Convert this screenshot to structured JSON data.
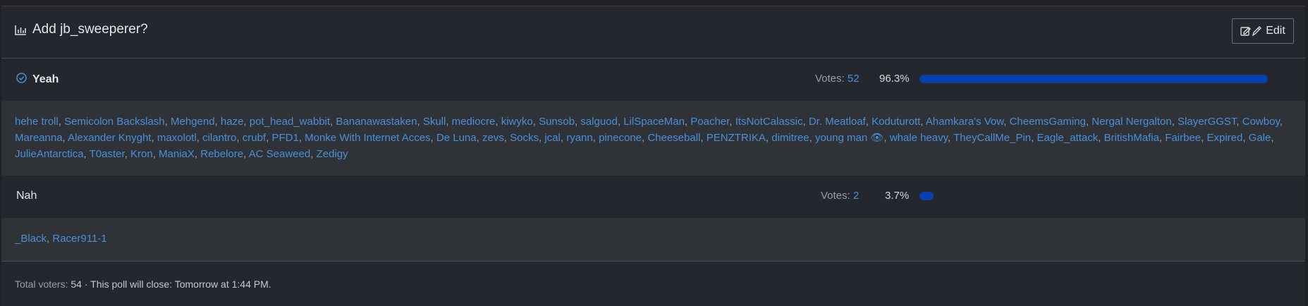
{
  "poll": {
    "title": "Add jb_sweeperer?",
    "title_icon": "bar-chart-icon",
    "edit_label": "Edit",
    "edit_icon": "edit-icon"
  },
  "options": [
    {
      "label": "Yeah",
      "selected": true,
      "votes_label": "Votes:",
      "votes": "52",
      "percent": "96.3%",
      "fraction": 0.963,
      "voters": [
        "hehe troll",
        "Semicolon Backslash",
        "Mehgend",
        "haze",
        "pot_head_wabbit",
        "Bananawastaken",
        "Skull",
        "mediocre",
        "kiwyko",
        "Sunsob",
        "salguod",
        "LilSpaceMan",
        "Poacher",
        "ItsNotCalassic",
        "Dr. Meatloaf",
        "Koduturott",
        "Ahamkara's Vow",
        "CheemsGaming",
        "Nergal Nergalton",
        "SlayerGGST",
        "Cowboy",
        "Mareanna",
        "Alexander Knyght",
        "maxolotl",
        "cilantro",
        "crubf",
        "PFD1",
        "Monke With Internet Acces",
        "De Luna",
        "zevs",
        "Socks",
        "jcal",
        "ryann",
        "pinecone",
        "Cheeseball",
        "PENZTRIKA",
        "dimitree",
        "young man 👁",
        "whale heavy",
        "TheyCallMe_Pin",
        "Eagle_attack",
        "BritishMafia",
        "Fairbee",
        "Expired",
        "Gale",
        "JulieAntarctica",
        "T0aster",
        "Kron",
        "ManiaX",
        "Rebelore",
        "AC Seaweed",
        "Zedigy"
      ]
    },
    {
      "label": "Nah",
      "selected": false,
      "votes_label": "Votes:",
      "votes": "2",
      "percent": "3.7%",
      "fraction": 0.037,
      "voters": [
        "_Black",
        "Racer911-1"
      ]
    }
  ],
  "footer": {
    "total_label": "Total voters:",
    "total": "54",
    "separator": " · ",
    "close_text": "This poll will close: Tomorrow at 1:44 PM."
  },
  "colors": {
    "accent_link": "#4a90d9",
    "bar_fill": "#0a3fb0",
    "background": "#24272d",
    "voter_panel": "#2f3237"
  }
}
